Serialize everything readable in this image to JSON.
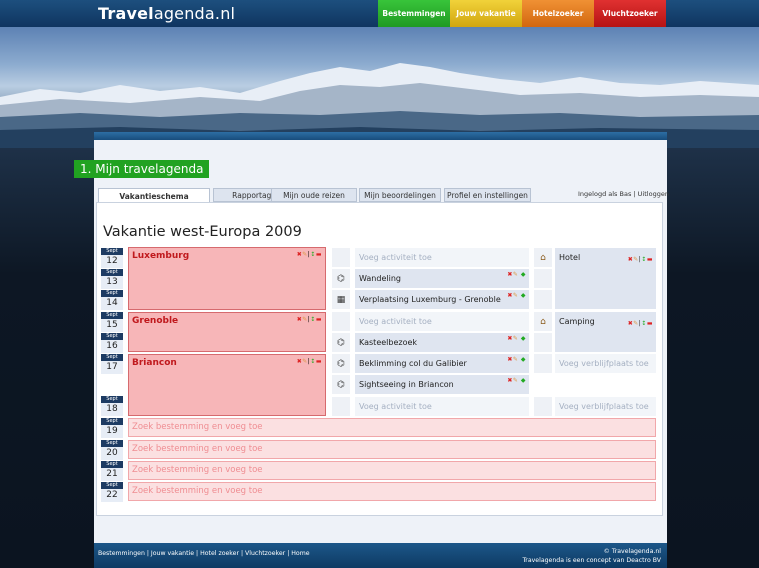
{
  "header": {
    "logo_bold": "Travel",
    "logo_light": "agenda.nl",
    "nav": [
      "Bestemmingen",
      "Jouw vakantie",
      "Hotelzoeker",
      "Vluchtzoeker"
    ]
  },
  "section_title": "1. Mijn travelagenda",
  "tabs": [
    "Vakantieschema",
    "Rapportages",
    "Mijn oude reizen",
    "Mijn beoordelingen",
    "Profiel en instellingen"
  ],
  "login": {
    "text": "Ingelogd als Bas",
    "separator": " | ",
    "logout": "Uitloggen"
  },
  "trip_title": "Vakantie west-Europa 2009",
  "days": [
    {
      "month": "Sept",
      "day": "12"
    },
    {
      "month": "Sept",
      "day": "13"
    },
    {
      "month": "Sept",
      "day": "14"
    },
    {
      "month": "Sept",
      "day": "15"
    },
    {
      "month": "Sept",
      "day": "16"
    },
    {
      "month": "Sept",
      "day": "17"
    },
    {
      "month": "Sept",
      "day": "18"
    },
    {
      "month": "Sept",
      "day": "19"
    },
    {
      "month": "Sept",
      "day": "20"
    },
    {
      "month": "Sept",
      "day": "21"
    },
    {
      "month": "Sept",
      "day": "22"
    }
  ],
  "destinations": [
    "Luxemburg",
    "Grenoble",
    "Briancon"
  ],
  "activities": {
    "add_placeholder": "Voeg activiteit toe",
    "items": [
      "Wandeling",
      "Verplaatsing Luxemburg - Grenoble",
      "Kasteelbezoek",
      "Beklimming col du Galibier",
      "Sightseeing in Briancon"
    ]
  },
  "stays": {
    "items": [
      "Hotel",
      "Camping"
    ],
    "add_placeholder": "Voeg verblijfplaats toe"
  },
  "search_placeholder": "Zoek bestemming en voeg toe",
  "footer": {
    "links": [
      "Bestemmingen",
      "Jouw vakantie",
      "Hotel zoeker",
      "Vluchtzoeker",
      "Home"
    ],
    "copyright": "© Travelagenda.nl",
    "concept": "Travelagenda is een concept van Deactro BV"
  },
  "icons": {
    "binoculars": "binoculars-icon",
    "map": "map-icon",
    "house": "house-icon"
  },
  "colors": {
    "nav_green": "#2aa92c",
    "nav_yellow": "#e3bb1f",
    "nav_orange": "#e27a20",
    "nav_red": "#c91f1f",
    "destination": "#f7b6b8",
    "title_green": "#21a221"
  }
}
